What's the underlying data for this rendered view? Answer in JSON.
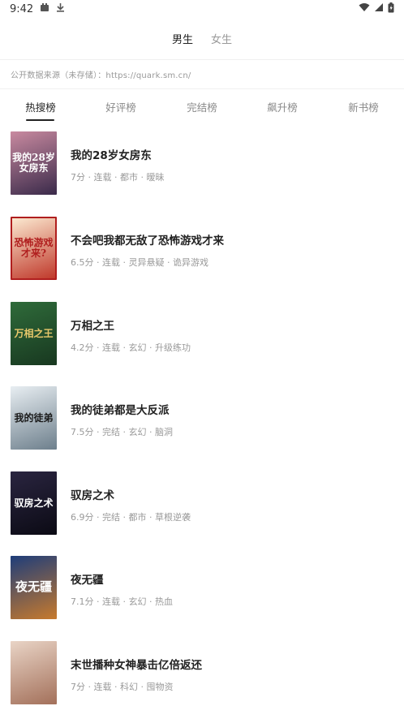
{
  "status_bar": {
    "time": "9:42"
  },
  "gender_tabs": [
    {
      "label": "男生",
      "active": true
    },
    {
      "label": "女生",
      "active": false
    }
  ],
  "source_notice": "公开数据来源（未存储）：https://quark.sm.cn/",
  "rank_tabs": [
    {
      "label": "热搜榜",
      "active": true
    },
    {
      "label": "好评榜",
      "active": false
    },
    {
      "label": "完结榜",
      "active": false
    },
    {
      "label": "飙升榜",
      "active": false
    },
    {
      "label": "新书榜",
      "active": false
    }
  ],
  "books": [
    {
      "title": "我的28岁女房东",
      "meta": "7分 · 连载 · 都市 · 暧昧",
      "cover_text": "我的28岁女房东",
      "cover_colors": [
        "#c98aa0",
        "#3a2a4a"
      ]
    },
    {
      "title": "不会吧我都无敌了恐怖游戏才来",
      "meta": "6.5分 · 连载 · 灵异悬疑 · 诡异游戏",
      "cover_text": "恐怖游戏才来?",
      "cover_colors": [
        "#fbe9d0",
        "#c0392b"
      ]
    },
    {
      "title": "万相之王",
      "meta": "4.2分 · 连载 · 玄幻 · 升级练功",
      "cover_text": "万相之王",
      "cover_colors": [
        "#2f6b3a",
        "#183820"
      ]
    },
    {
      "title": "我的徒弟都是大反派",
      "meta": "7.5分 · 完结 · 玄幻 · 脑洞",
      "cover_text": "我的徒弟",
      "cover_colors": [
        "#e8eef2",
        "#6d7f8c"
      ]
    },
    {
      "title": "驭房之术",
      "meta": "6.9分 · 完结 · 都市 · 草根逆袭",
      "cover_text": "驭房之术",
      "cover_colors": [
        "#2a2540",
        "#0b0a14"
      ]
    },
    {
      "title": "夜无疆",
      "meta": "7.1分 · 连载 · 玄幻 · 热血",
      "cover_text": "夜无疆",
      "cover_colors": [
        "#1e3d7a",
        "#c77a2d"
      ]
    },
    {
      "title": "末世播种女神暴击亿倍返还",
      "meta": "7分 · 连载 · 科幻 · 囤物资",
      "cover_text": "",
      "cover_colors": [
        "#e9d4c6",
        "#a3705a"
      ]
    }
  ]
}
